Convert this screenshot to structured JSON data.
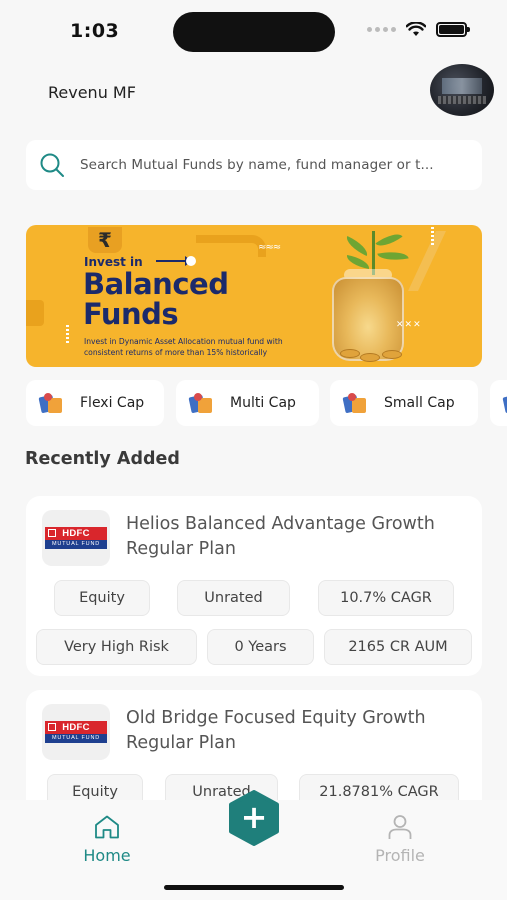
{
  "status": {
    "time": "1:03"
  },
  "header": {
    "title": "Revenu MF"
  },
  "search": {
    "placeholder": "Search Mutual Funds by name, fund manager or t..."
  },
  "banner": {
    "eyebrow": "Invest in",
    "title_line1": "Balanced",
    "title_line2": "Funds",
    "subtitle": "Invest in Dynamic Asset Allocation mutual fund with consistent returns of more than 15% historically",
    "rupee_symbol": "₹",
    "accent_color": "#f6b42c",
    "title_color": "#1b2a6b"
  },
  "categories": [
    {
      "label": "Flexi Cap"
    },
    {
      "label": "Multi Cap"
    },
    {
      "label": "Small Cap"
    }
  ],
  "recent": {
    "title": "Recently Added",
    "funds": [
      {
        "logo_top": "HDFC",
        "logo_bottom": "MUTUAL FUND",
        "name": "Helios Balanced Advantage Growth Regular Plan",
        "tags_row1": [
          "Equity",
          "Unrated",
          "10.7% CAGR"
        ],
        "tags_row2": [
          "Very High Risk",
          "0 Years",
          "2165 CR AUM"
        ]
      },
      {
        "logo_top": "HDFC",
        "logo_bottom": "MUTUAL FUND",
        "name": "Old Bridge Focused Equity Growth Regular Plan",
        "tags_row1": [
          "Equity",
          "Unrated",
          "21.8781% CAGR"
        ]
      }
    ]
  },
  "nav": {
    "home": "Home",
    "add": "+",
    "profile": "Profile",
    "active_color": "#1f8a86",
    "inactive_color": "#b4b4b4"
  }
}
